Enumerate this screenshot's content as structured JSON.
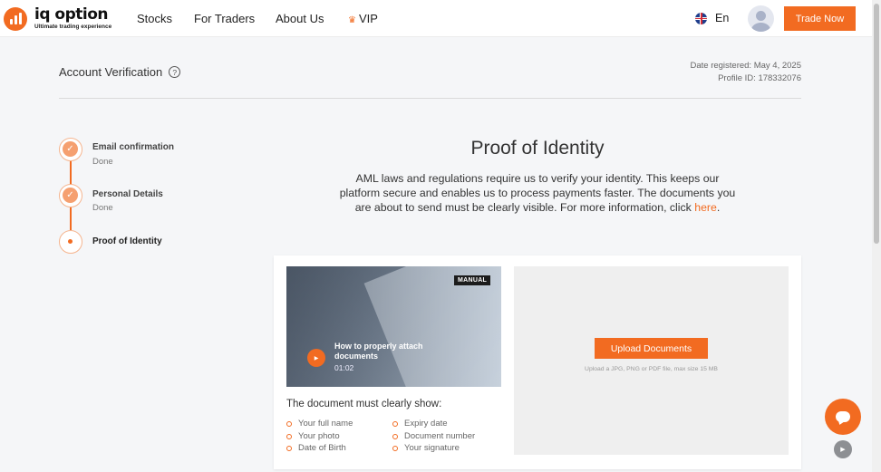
{
  "header": {
    "logo": {
      "name": "iq option",
      "tagline": "Ultimate trading experience"
    },
    "nav": [
      {
        "label": "Stocks"
      },
      {
        "label": "For Traders"
      },
      {
        "label": "About Us"
      },
      {
        "label": "VIP"
      }
    ],
    "language": "En",
    "trade_button": "Trade Now"
  },
  "page": {
    "title": "Account Verification",
    "help_symbol": "?",
    "date_registered": "Date registered: May 4, 2025",
    "profile_id": "Profile ID: 178332076"
  },
  "steps": [
    {
      "title": "Email confirmation",
      "status": "Done",
      "state": "done"
    },
    {
      "title": "Personal Details",
      "status": "Done",
      "state": "done"
    },
    {
      "title": "Proof of Identity",
      "status": "",
      "state": "active"
    }
  ],
  "main": {
    "title": "Proof of Identity",
    "description": "AML laws and regulations require us to verify your identity. This keeps our platform secure and enables us to process payments faster. The documents you are about to send must be clearly visible. For more information, click",
    "link": "here",
    "link_suffix": "."
  },
  "video": {
    "badge": "MANUAL",
    "title": "How to properly attach documents",
    "duration": "01:02"
  },
  "requirements": {
    "heading": "The document must clearly show:",
    "left": [
      "Your full name",
      "Your photo",
      "Date of Birth"
    ],
    "right": [
      "Expiry date",
      "Document number",
      "Your signature"
    ]
  },
  "upload": {
    "button": "Upload Documents",
    "hint": "Upload a JPG, PNG or PDF file, max size 15 MB"
  },
  "colors": {
    "accent": "#f26b21",
    "text": "#333333"
  },
  "icons": {
    "help": "question-circle-icon",
    "chat": "chat-icon",
    "play": "play-icon",
    "check": "check-icon"
  }
}
